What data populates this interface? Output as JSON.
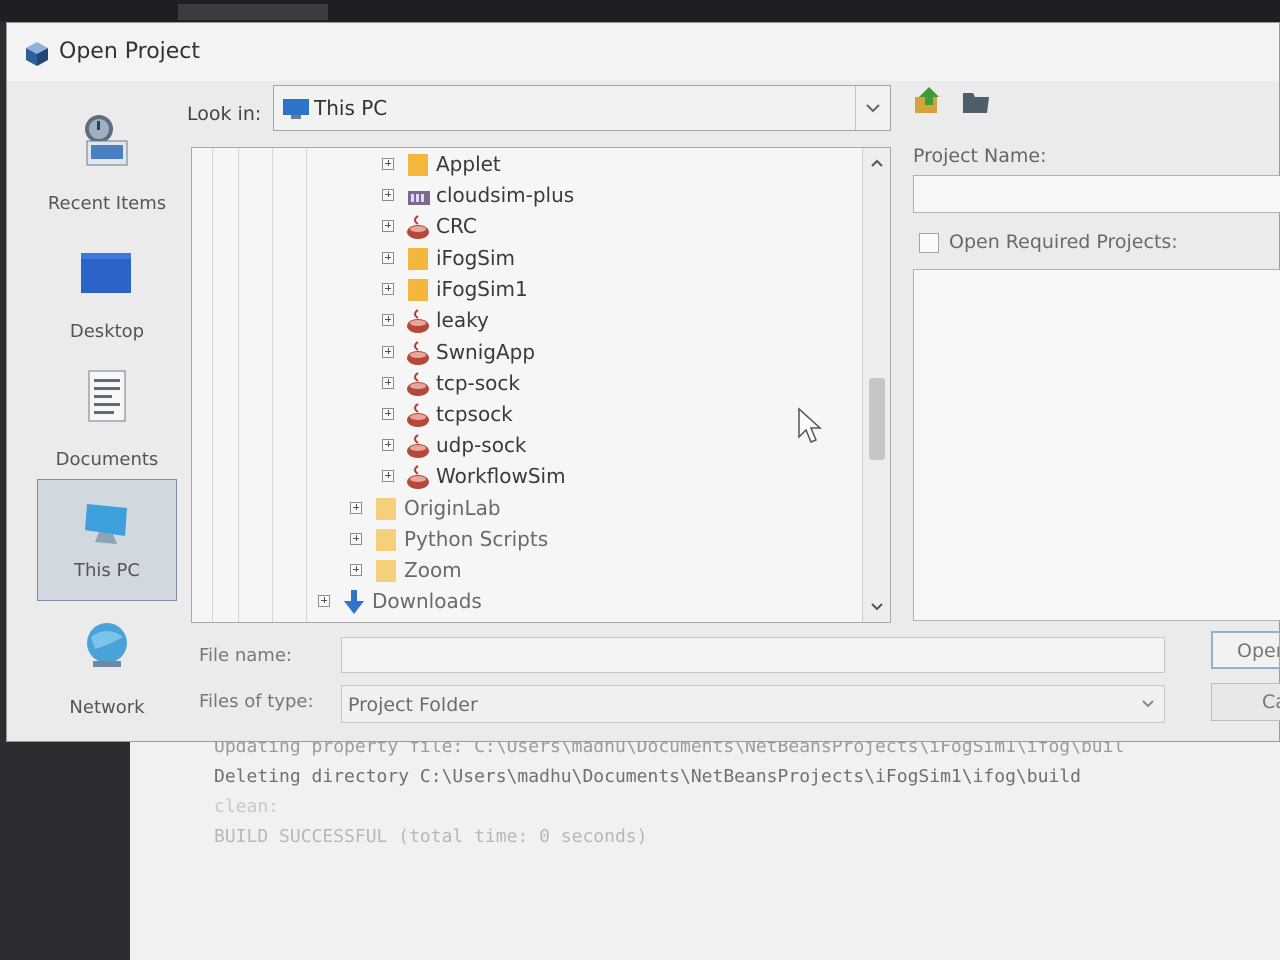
{
  "dialog": {
    "title": "Open Project",
    "look_in_label": "Look in:",
    "look_in_value": "This PC",
    "project_name_label": "Project Name:",
    "project_name_value": "",
    "open_required_label": "Open Required Projects:",
    "file_name_label": "File name:",
    "file_name_value": "",
    "files_of_type_label": "Files of type:",
    "files_of_type_value": "Project Folder",
    "open_button": "Open",
    "cancel_button": "Cancel"
  },
  "sidebar": {
    "items": [
      {
        "label": "Recent Items",
        "icon": "recent-items-icon"
      },
      {
        "label": "Desktop",
        "icon": "desktop-icon"
      },
      {
        "label": "Documents",
        "icon": "documents-icon"
      },
      {
        "label": "This PC",
        "icon": "computer-icon",
        "selected": true
      },
      {
        "label": "Network",
        "icon": "network-icon"
      }
    ]
  },
  "tree": {
    "items": [
      {
        "label": "Applet",
        "icon": "folder-icon"
      },
      {
        "label": "cloudsim-plus",
        "icon": "library-icon"
      },
      {
        "label": "CRC",
        "icon": "java-project-icon"
      },
      {
        "label": "iFogSim",
        "icon": "folder-icon"
      },
      {
        "label": "iFogSim1",
        "icon": "folder-icon"
      },
      {
        "label": "leaky",
        "icon": "java-project-icon"
      },
      {
        "label": "SwnigApp",
        "icon": "java-project-icon"
      },
      {
        "label": "tcp-sock",
        "icon": "java-project-icon"
      },
      {
        "label": "tcpsock",
        "icon": "java-project-icon"
      },
      {
        "label": "udp-sock",
        "icon": "java-project-icon"
      },
      {
        "label": "WorkflowSim",
        "icon": "java-project-icon"
      },
      {
        "label": "OriginLab",
        "icon": "folder-icon"
      },
      {
        "label": "Python Scripts",
        "icon": "folder-icon"
      },
      {
        "label": "Zoom",
        "icon": "folder-icon"
      },
      {
        "label": "Downloads",
        "icon": "download-arrow-icon"
      }
    ]
  },
  "console": {
    "lines": [
      "Updating property file: C:\\Users\\madhu\\Documents\\NetBeansProjects\\iFogSim1\\ifog\\buil",
      "Deleting directory C:\\Users\\madhu\\Documents\\NetBeansProjects\\iFogSim1\\ifog\\build",
      "clean:",
      "BUILD SUCCESSFUL (total time: 0 seconds)"
    ]
  },
  "colors": {
    "accent": "#2f74c9",
    "folder": "#f4b73e",
    "java_cup": "#b5483a"
  }
}
